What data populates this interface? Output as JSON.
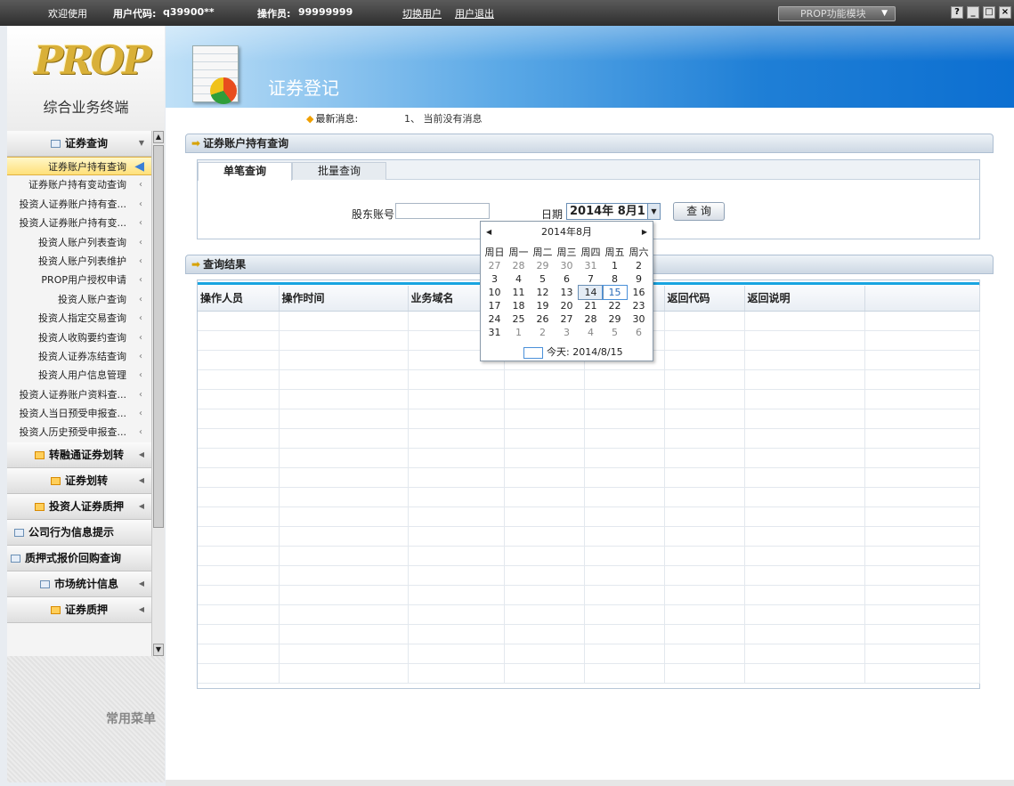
{
  "topbar": {
    "welcome": "欢迎使用",
    "user_code_label": "用户代码:",
    "user_code": "q39900**",
    "operator_label": "操作员:",
    "operator": "99999999",
    "switch_user": "切换用户",
    "logout": "用户退出",
    "module_select": "PROP功能模块",
    "window_buttons": [
      "?",
      "_",
      "□",
      "×"
    ]
  },
  "logo": {
    "text": "PROP",
    "subtitle": "综合业务终端"
  },
  "sidebar": {
    "groups": [
      {
        "label": "证券查询",
        "icon": "grid-icon",
        "expanded": true,
        "items": [
          {
            "label": "证券账户持有查询",
            "active": true
          },
          {
            "label": "证券账户持有变动查询"
          },
          {
            "label": "投资人证券账户持有查..."
          },
          {
            "label": "投资人证券账户持有变..."
          },
          {
            "label": "投资人账户列表查询"
          },
          {
            "label": "投资人账户列表维护"
          },
          {
            "label": "PROP用户授权申请"
          },
          {
            "label": "投资人账户查询"
          },
          {
            "label": "投资人指定交易查询"
          },
          {
            "label": "投资人收购要约查询"
          },
          {
            "label": "投资人证券冻结查询"
          },
          {
            "label": "投资人用户信息管理"
          },
          {
            "label": "投资人证券账户资料查..."
          },
          {
            "label": "投资人当日预受申报查..."
          },
          {
            "label": "投资人历史预受申报查..."
          }
        ]
      },
      {
        "label": "转融通证券划转",
        "icon": "orange-icon"
      },
      {
        "label": "证券划转",
        "icon": "orange-icon"
      },
      {
        "label": "投资人证券质押",
        "icon": "orange-icon"
      },
      {
        "label": "公司行为信息提示",
        "icon": "grid-icon"
      },
      {
        "label": "质押式报价回购查询",
        "icon": "grid-icon"
      },
      {
        "label": "市场统计信息",
        "icon": "grid-icon"
      },
      {
        "label": "证券质押",
        "icon": "orange-icon"
      }
    ],
    "common_menu": "常用菜单"
  },
  "header": {
    "title": "证券登记",
    "news_label": "最新消息:",
    "news_text": "1、 当前没有消息"
  },
  "query_panel": {
    "title": "证券账户持有查询",
    "tabs": [
      "单笔查询",
      "批量查询"
    ],
    "account_label": "股东账号",
    "account_value": "",
    "date_label": "日期",
    "date_value": "2014年 8月1",
    "query_button": "查 询"
  },
  "results": {
    "title": "查询结果",
    "columns": [
      "操作人员",
      "操作时间",
      "业务域名",
      "",
      "",
      "返回代码",
      "返回说明",
      ""
    ]
  },
  "calendar": {
    "header": "2014年8月",
    "weekdays": [
      "周日",
      "周一",
      "周二",
      "周三",
      "周四",
      "周五",
      "周六"
    ],
    "weeks": [
      [
        "27",
        "28",
        "29",
        "30",
        "31",
        "1",
        "2"
      ],
      [
        "3",
        "4",
        "5",
        "6",
        "7",
        "8",
        "9"
      ],
      [
        "10",
        "11",
        "12",
        "13",
        "14",
        "15",
        "16"
      ],
      [
        "17",
        "18",
        "19",
        "20",
        "21",
        "22",
        "23"
      ],
      [
        "24",
        "25",
        "26",
        "27",
        "28",
        "29",
        "30"
      ],
      [
        "31",
        "1",
        "2",
        "3",
        "4",
        "5",
        "6"
      ]
    ],
    "today_label": "今天: 2014/8/15"
  },
  "colors": {
    "banner": "#1f7fd6",
    "accent_blue": "#18a4e0",
    "active_item": "#ffe07a"
  }
}
